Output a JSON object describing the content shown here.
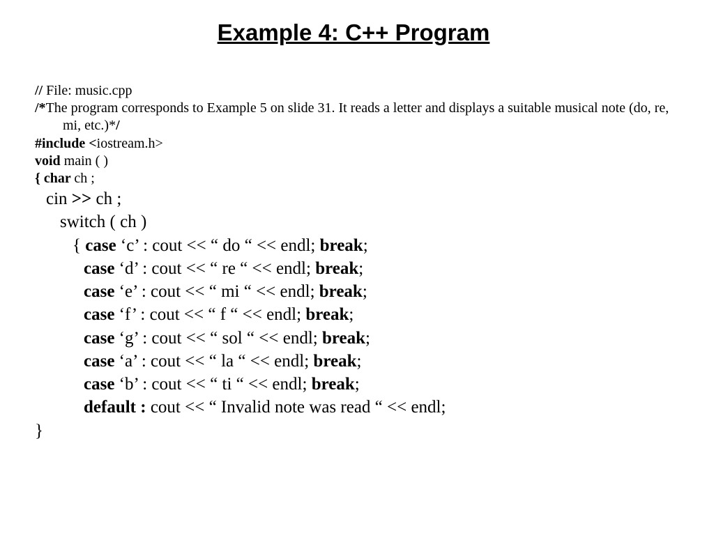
{
  "title": "Example 4: C++ Program",
  "l01a": "// ",
  "l01b": "File: music.cpp",
  "l02a": "/*",
  "l02b": "The program corresponds to Example 5 on slide 31. It reads a letter and displays a suitable musical note (do, re, mi, etc.)*",
  "l02c": "/",
  "l03a": "#include <",
  "l03b": "iostream.h>",
  "l04a": "void ",
  "l04b": "main ( )",
  "l05a": "{ char ",
  "l05b": "ch ;",
  "l06a": "cin ",
  "l06b": ">> ",
  "l06c": "ch ;",
  "l07": "switch  ( ch )",
  "l08a": "{ ",
  "l08b": "case",
  "l08c": " ‘c’ : cout <<  “ do “ << endl; ",
  "l08d": "break",
  "l08e": ";",
  "l09b": "case",
  "l09c": " ‘d’ : cout <<  “ re “ << endl; ",
  "l09d": "break",
  "l09e": ";",
  "l10b": "case",
  "l10c": " ‘e’ : cout <<  “ mi “ << endl; ",
  "l10d": "break",
  "l10e": ";",
  "l11b": "case",
  "l11c": " ‘f’ : cout <<  “ f “ << endl; ",
  "l11d": "break",
  "l11e": ";",
  "l12b": "case",
  "l12c": " ‘g’ : cout <<  “ sol “ << endl; ",
  "l12d": "break",
  "l12e": ";",
  "l13b": "case",
  "l13c": " ‘a’ : cout <<  “ la “ << endl; ",
  "l13d": "break",
  "l13e": ";",
  "l14b": "case",
  "l14c": " ‘b’ : cout <<  “ ti “ << endl; ",
  "l14d": "break",
  "l14e": ";",
  "l15b": "default :",
  "l15c": "  cout << “ Invalid note was read “ << endl;",
  "l16": "}"
}
